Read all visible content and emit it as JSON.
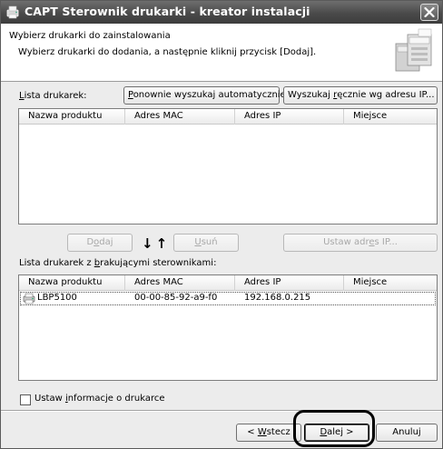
{
  "window": {
    "title": "CAPT Sterownik drukarki - kreator instalacji",
    "icons": {
      "app": "printer-app-icon",
      "close": "close-icon",
      "header_art": "printers-illustration"
    }
  },
  "header": {
    "title": "Wybierz drukarki do zainstalowania",
    "subtitle": "Wybierz drukarki do dodania, a następnie kliknij przycisk [Dodaj]."
  },
  "printer_list": {
    "label_accel": "L",
    "label_rest": "ista drukarek:",
    "rescan_button": {
      "accel": "P",
      "rest": "onownie wyszukaj automatycznie"
    },
    "manual_search_button": {
      "pre": "Wyszukaj ",
      "accel": "r",
      "post": "ęcznie wg adresu IP..."
    },
    "columns": [
      "Nazwa produktu",
      "Adres MAC",
      "Adres IP",
      "Miejsce"
    ],
    "rows": []
  },
  "actions": {
    "add": {
      "pre": "D",
      "accel": "o",
      "post": "daj"
    },
    "remove": {
      "accel": "U",
      "post": "suń"
    },
    "arrows": "↓↑",
    "set_ip": {
      "pre": "Ustaw adr",
      "accel": "e",
      "post": "s IP..."
    }
  },
  "missing_drivers_list": {
    "label_pre": "Lista drukarek z ",
    "label_accel": "b",
    "label_post": "rakującymi sterownikami:",
    "columns": [
      "Nazwa produktu",
      "Adres MAC",
      "Adres IP",
      "Miejsce"
    ],
    "rows": [
      {
        "name": "LBP5100",
        "mac": "00-00-85-92-a9-f0",
        "ip": "192.168.0.215",
        "location": "",
        "icon": "printer-icon"
      }
    ]
  },
  "set_printer_info": {
    "pre": "Ustaw ",
    "accel": "i",
    "post": "nformacje o drukarce",
    "checked": false
  },
  "footer": {
    "back": {
      "pre": "< ",
      "accel": "W",
      "post": "stecz"
    },
    "next": {
      "accel": "D",
      "post": "alej >"
    },
    "cancel": "Anuluj"
  }
}
